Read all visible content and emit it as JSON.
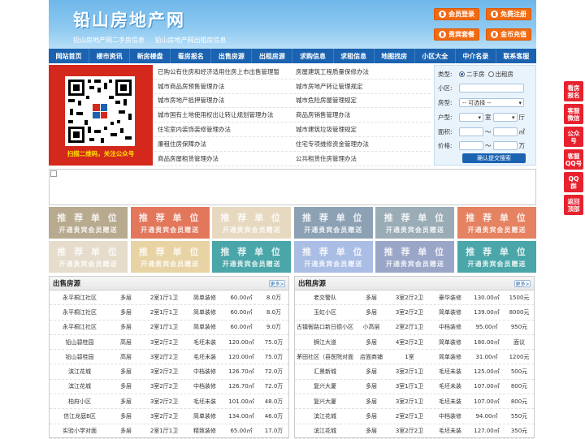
{
  "header": {
    "title": "铅山房地产网",
    "sub": [
      "铅山房地产网二手房信息",
      "铅山房地产网出租房信息"
    ],
    "buttons": [
      "会员登录",
      "免费注册",
      "贵宾套餐",
      "金币充值"
    ]
  },
  "nav": [
    "网站首页",
    "楼市资讯",
    "新房楼盘",
    "看房报名",
    "出售房源",
    "出租房源",
    "求购信息",
    "求租信息",
    "地图找房",
    "小区大全",
    "中介名录",
    "联系客服"
  ],
  "qr_caption": "扫描二维码，关注公众号",
  "links": [
    [
      "已购公有住房和经济适用住房上市出售管理暂",
      "房屋建筑工程质量保修办法"
    ],
    [
      "城市商品房预售管理办法",
      "城市房地产转让管理规定"
    ],
    [
      "城市房地产抵押管理办法",
      "城市危险房屋管理规定"
    ],
    [
      "城市国有土地使用权出让转让规划管理办法",
      "商品房销售管理办法"
    ],
    [
      "住宅室内装饰装修管理办法",
      "城市建筑垃圾管理规定"
    ],
    [
      "廉租住房保障办法",
      "住宅专项维修资金管理办法"
    ],
    [
      "商品房屋租赁管理办法",
      "公共租赁住房管理办法"
    ]
  ],
  "search": {
    "type_label": "类型:",
    "type_options": [
      "二手房",
      "出租房"
    ],
    "community_label": "小区:",
    "house_label": "房型:",
    "house_select": "-- 可选择 --",
    "layout_label": "户型:",
    "layout_room": "室",
    "layout_hall": "厅",
    "area_label": "面积:",
    "area_sep": "～",
    "area_unit": "㎡",
    "price_label": "价格:",
    "price_sep": "～",
    "price_unit": "万",
    "submit": "确认提交搜索"
  },
  "ads": {
    "t1": "推 荐 单 位",
    "t2": "开通贵宾会员赠送"
  },
  "sale": {
    "title": "出售房源",
    "more": "更多>",
    "rows": [
      [
        "永平桐江社区",
        "多层",
        "2室1厅1卫",
        "简单装修",
        "60.00㎡",
        "8.0万"
      ],
      [
        "永平桐江社区",
        "多层",
        "2室1厅1卫",
        "简单装修",
        "60.00㎡",
        "8.0万"
      ],
      [
        "永平桐江社区",
        "多层",
        "2室1厅1卫",
        "简单装修",
        "60.00㎡",
        "9.0万"
      ],
      [
        "铅山碧桂园",
        "高层",
        "3室2厅2卫",
        "毛坯未装",
        "120.00㎡",
        "75.0万"
      ],
      [
        "铅山碧桂园",
        "高层",
        "3室2厅2卫",
        "毛坯未装",
        "120.00㎡",
        "75.0万"
      ],
      [
        "滨江花城",
        "多层",
        "3室2厅2卫",
        "中档装修",
        "126.70㎡",
        "72.0万"
      ],
      [
        "滨江花城",
        "多层",
        "3室2厅2卫",
        "中档装修",
        "126.70㎡",
        "72.0万"
      ],
      [
        "柏府小区",
        "多层",
        "3室2厅2卫",
        "毛坯未装",
        "101.00㎡",
        "48.0万"
      ],
      [
        "信江龙庭B区",
        "多层",
        "3室2厅2卫",
        "简单装修",
        "134.00㎡",
        "46.0万"
      ],
      [
        "实验小学对面",
        "多层",
        "2室1厅1卫",
        "精致装修",
        "65.00㎡",
        "17.0万"
      ]
    ]
  },
  "rent": {
    "title": "出租房源",
    "more": "更多>",
    "rows": [
      [
        "老交警队",
        "多层",
        "3室2厅2卫",
        "豪华装修",
        "130.00㎡",
        "1500元"
      ],
      [
        "玉虹小区",
        "多层",
        "3室2厅2卫",
        "简单装修",
        "139.00㎡",
        "8000元"
      ],
      [
        "古镇衙路口新日德小区",
        "小高层",
        "2室2厅1卫",
        "中档装修",
        "95.00㎡",
        "950元"
      ],
      [
        "狮江大道",
        "多层",
        "4室2厅2卫",
        "简单装修",
        "180.00㎡",
        "面议"
      ],
      [
        "茅田社区（县医院对面",
        "店面商铺",
        "1室",
        "简单装修",
        "31.00㎡",
        "1200元"
      ],
      [
        "汇景新城",
        "多层",
        "3室2厅1卫",
        "毛坯未装",
        "125.00㎡",
        "500元"
      ],
      [
        "复兴大厦",
        "多层",
        "3室1厅1卫",
        "毛坯未装",
        "107.00㎡",
        "800元"
      ],
      [
        "复兴大厦",
        "多层",
        "3室2厅1卫",
        "毛坯未装",
        "107.00㎡",
        "800元"
      ],
      [
        "滨江花城",
        "多层",
        "2室2厅1卫",
        "中档装修",
        "94.00㎡",
        "550元"
      ],
      [
        "滨江花城",
        "多层",
        "3室2厅2卫",
        "毛坯未装",
        "127.00㎡",
        "350元"
      ]
    ]
  },
  "side": [
    "看房报名",
    "客服微信",
    "公众号",
    "客服QQ号",
    "QQ群",
    "返回顶部"
  ],
  "colors": {
    "nav": "#1b63b0",
    "orange": "#f26a12",
    "red": "#d4281c",
    "side": "#e8212e",
    "ads": [
      "#b8aa8f",
      "#e2775c",
      "#e7d9c0",
      "#8da1b5",
      "#9aacb6",
      "#e58261",
      "#e5dccb",
      "#e8d3a4",
      "#4aa6a8",
      "#a9bde5",
      "#9aa6c8",
      "#4aa6a8"
    ]
  }
}
